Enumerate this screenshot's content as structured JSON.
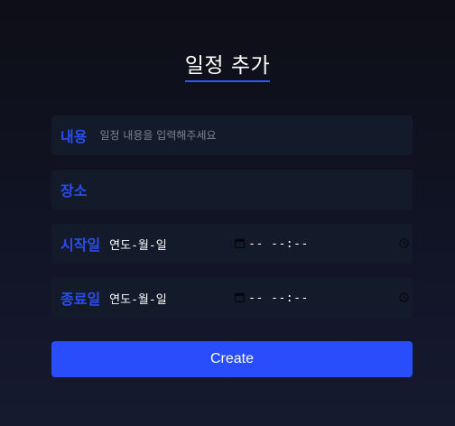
{
  "form": {
    "title": "일정 추가",
    "content": {
      "label": "내용",
      "placeholder": "일정 내용을 입력해주세요",
      "value": ""
    },
    "place": {
      "label": "장소",
      "placeholder": "",
      "value": ""
    },
    "start": {
      "label": "시작일",
      "date_value": "연도-월-일",
      "time_value": "-- --:--"
    },
    "end": {
      "label": "종료일",
      "date_value": "연도-월-일",
      "time_value": "-- --:--"
    },
    "submit_label": "Create"
  },
  "icons": {
    "date": "calendar-icon",
    "time": "clock-icon"
  },
  "colors": {
    "accent": "#2d4cf0",
    "button": "#2a4dfb",
    "field_bg": "#131b2b",
    "underline": "#2f55ff"
  }
}
